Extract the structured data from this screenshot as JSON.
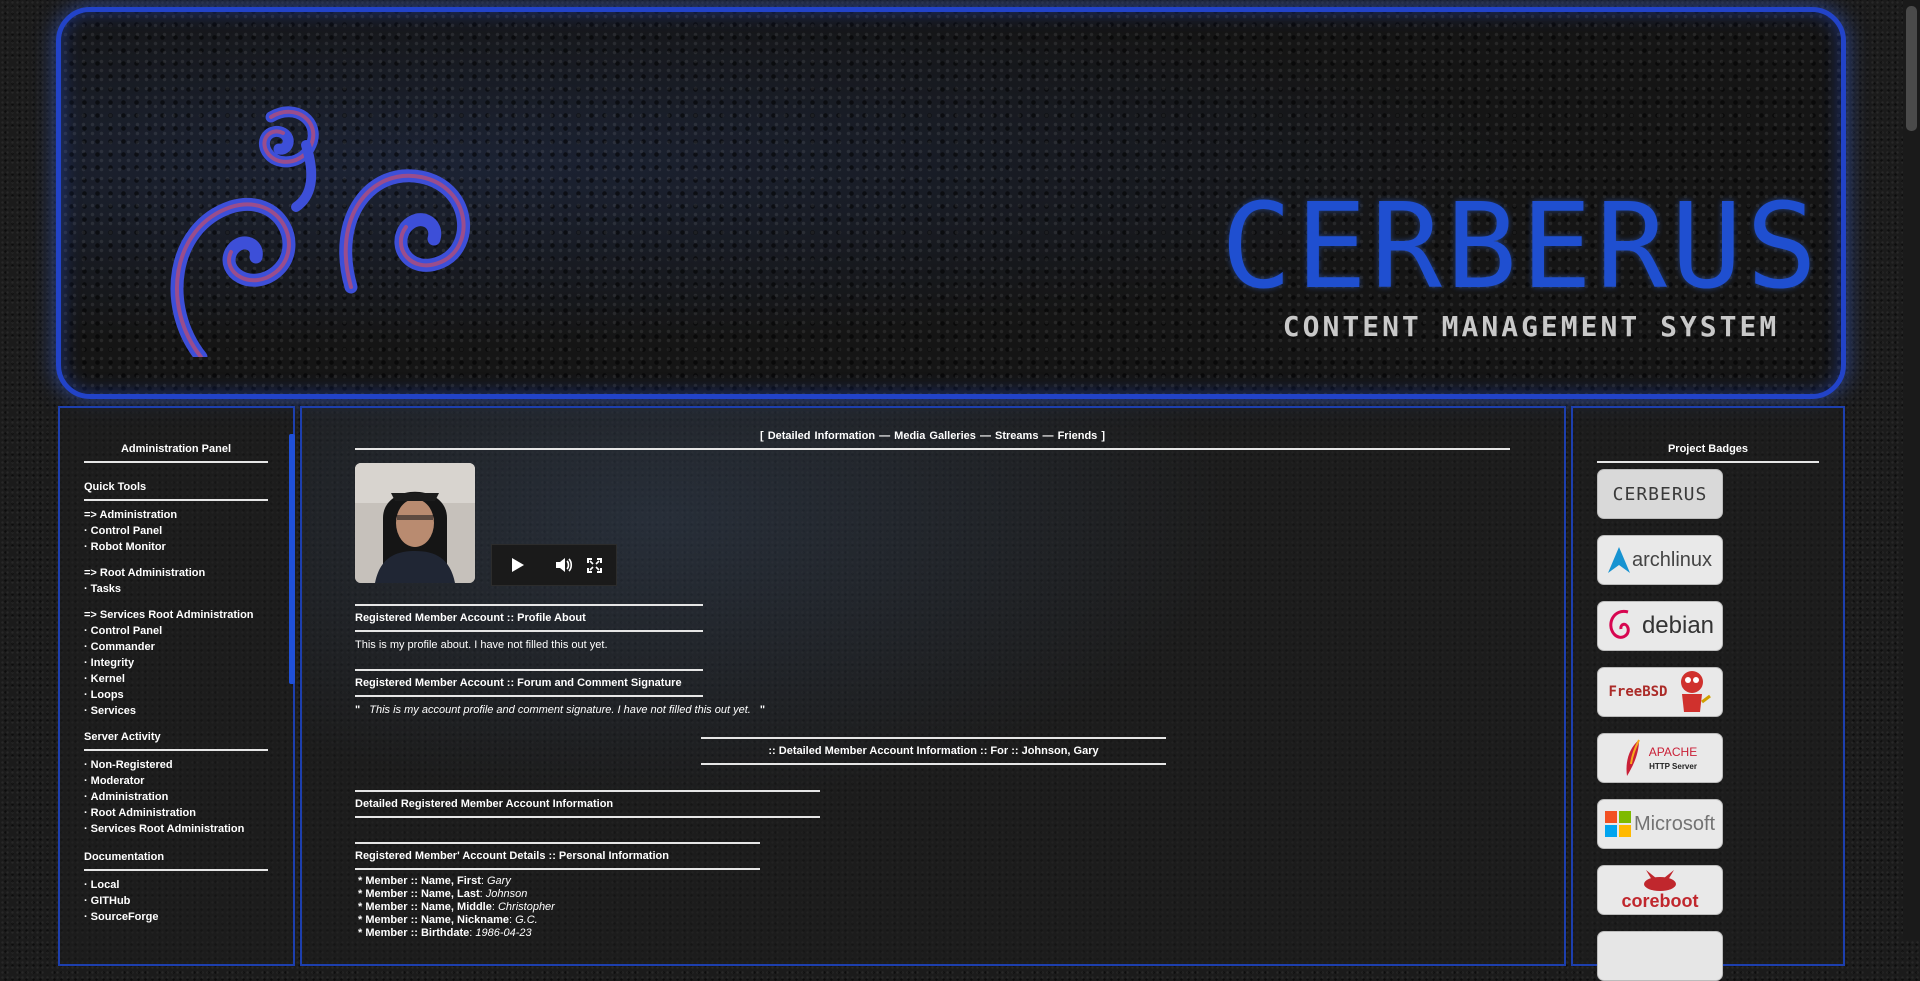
{
  "banner": {
    "title": "CERBERUS",
    "subtitle": "CONTENT MANAGEMENT SYSTEM",
    "accent_color": "#2243c8"
  },
  "left_panel": {
    "title": "Administration Panel",
    "quick_tools": {
      "heading": "Quick Tools",
      "administration_head": "=> Administration",
      "administration_items": [
        "Control Panel",
        "Robot Monitor"
      ],
      "root_head": "=> Root Administration",
      "root_items": [
        "Tasks"
      ],
      "services_head": "=> Services Root Administration",
      "services_items": [
        "Control Panel",
        "Commander",
        "Integrity",
        "Kernel",
        "Loops",
        "Services"
      ]
    },
    "server_activity": {
      "heading": "Server Activity",
      "items": [
        "Non-Registered",
        "Moderator",
        "Administration",
        "Root Administration",
        "Services Root Administration"
      ]
    },
    "documentation": {
      "heading": "Documentation",
      "items": [
        "Local",
        "GITHub",
        "SourceForge"
      ]
    }
  },
  "center": {
    "nav": {
      "open": "[",
      "detailed": "Detailed Information",
      "sep1": "—",
      "media": "Media Galleries",
      "sep2": "—",
      "streams": "Streams",
      "sep3": "—",
      "friends": "Friends",
      "close": "]"
    },
    "profile_about": {
      "title": "Registered Member Account :: Profile About",
      "text": "This is my profile about. I have not filled this out yet."
    },
    "signature": {
      "title": "Registered Member Account :: Forum and Comment Signature",
      "open_quote": "\"",
      "text": "This is my account profile and comment signature. I have not filled this out yet.",
      "close_quote": "\""
    },
    "detail_header": ":: Detailed Member Account Information :: For :: Johnson, Gary",
    "detailed_info_title": "Detailed Registered Member Account Information",
    "personal": {
      "title": "Registered Member' Account Details :: Personal Information",
      "fields": [
        {
          "label": "* Member :: Name, First",
          "value": "Gary"
        },
        {
          "label": "* Member :: Name, Last",
          "value": "Johnson"
        },
        {
          "label": "* Member :: Name, Middle",
          "value": "Christopher"
        },
        {
          "label": "* Member :: Name, Nickname",
          "value": "G.C."
        },
        {
          "label": "* Member :: Birthdate",
          "value": "1986-04-23"
        }
      ]
    },
    "player_icons": [
      "play-icon",
      "volume-icon",
      "fullscreen-icon"
    ]
  },
  "right_panel": {
    "title": "Project Badges",
    "badges": [
      {
        "name": "CERBERUS",
        "color": "#3a3a3a"
      },
      {
        "name": "archlinux",
        "color": "#1793d1"
      },
      {
        "name": "debian",
        "color": "#d70751"
      },
      {
        "name": "FreeBSD",
        "color": "#ab2b28"
      },
      {
        "name": "APACHE",
        "sub": "HTTP Server",
        "color": "#c92037"
      },
      {
        "name": "Microsoft",
        "color": "#737373"
      },
      {
        "name": "coreboot",
        "color": "#c0272d"
      }
    ]
  }
}
